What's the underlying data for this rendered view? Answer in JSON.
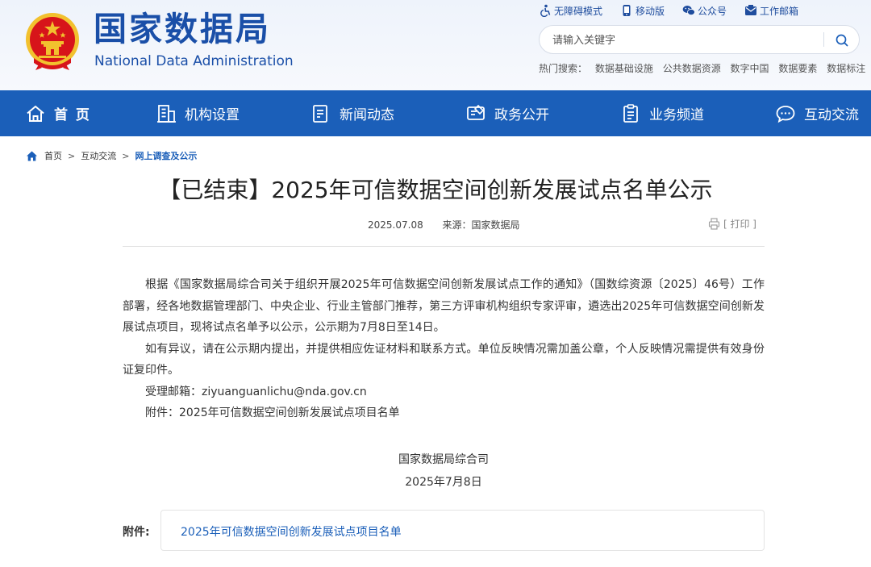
{
  "header": {
    "title": "国家数据局",
    "subtitle": "National Data Administration",
    "utility_links": [
      "无障碍模式",
      "移动版",
      "公众号",
      "工作邮箱"
    ],
    "search_placeholder": "请输入关键字",
    "hot_search_label": "热门搜索：",
    "hot_search_items": [
      "数据基础设施",
      "公共数据资源",
      "数字中国",
      "数据要素",
      "数据标注"
    ]
  },
  "nav": {
    "items": [
      "首 页",
      "机构设置",
      "新闻动态",
      "政务公开",
      "业务频道",
      "互动交流"
    ]
  },
  "breadcrumb": [
    "首页",
    "互动交流",
    "网上调查及公示"
  ],
  "article": {
    "title": "【已结束】2025年可信数据空间创新发展试点名单公示",
    "date": "2025.07.08",
    "source": "来源：国家数据局",
    "print_label": "[ 打印 ]",
    "paragraphs": [
      "根据《国家数据局综合司关于组织开展2025年可信数据空间创新发展试点工作的通知》（国数综资源〔2025〕46号）工作部署，经各地数据管理部门、中央企业、行业主管部门推荐，第三方评审机构组织专家评审，遴选出2025年可信数据空间创新发展试点项目，现将试点名单予以公示，公示期为7月8日至14日。",
      "如有异议，请在公示期内提出，并提供相应佐证材料和联系方式。单位反映情况需加盖公章，个人反映情况需提供有效身份证复印件。",
      "受理邮箱：ziyuanguanlichu@nda.gov.cn",
      "附件：2025年可信数据空间创新发展试点项目名单"
    ],
    "signature_org": "国家数据局综合司",
    "signature_date": "2025年7月8日",
    "attachment_label": "附件:",
    "attachment_link": "2025年可信数据空间创新发展试点项目名单"
  },
  "colors": {
    "brand_blue": "#1b5fb9",
    "title_blue": "#1a4fa8",
    "emblem_red": "#d7141a",
    "emblem_gold": "#f2c12e"
  }
}
